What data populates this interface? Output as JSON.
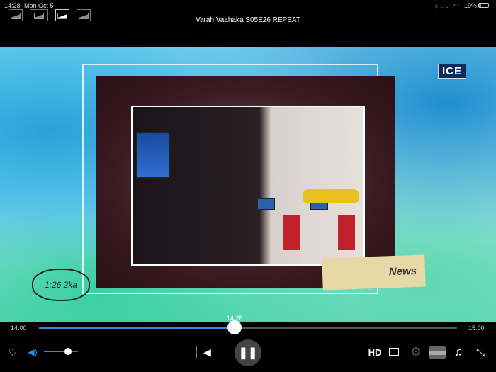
{
  "status_bar": {
    "time": "14:28",
    "date": "Mon Oct 5",
    "battery": "19%"
  },
  "title": "Varah Vaahaka S05E26 REPEAT",
  "video": {
    "channel_logo": "ICE",
    "news_label": "News",
    "bubble_text": "1:26 2ka"
  },
  "timeline": {
    "start": "14:00",
    "end": "15:00",
    "current": "14:28",
    "progress": 0.467
  },
  "volume": {
    "level": 0.7
  },
  "controls": {
    "hd_label": "HD"
  },
  "colors": {
    "accent": "#2b8fe0"
  }
}
